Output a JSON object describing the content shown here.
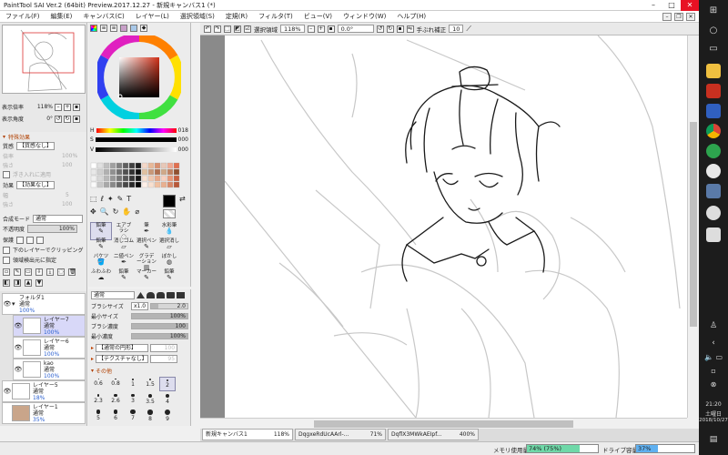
{
  "window": {
    "title": "PaintTool SAI Ver.2 (64bit) Preview.2017.12.27 - 新規キャンバス1 (*)"
  },
  "menu": {
    "items": [
      "ファイル(F)",
      "編集(E)",
      "キャンバス(C)",
      "レイヤー(L)",
      "選択領域(S)",
      "定規(R)",
      "フィルタ(T)",
      "ビュー(V)",
      "ウィンドウ(W)",
      "ヘルプ(H)"
    ]
  },
  "navigator": {
    "zoom_label": "表示倍率",
    "zoom_value": "118%",
    "angle_label": "表示角度",
    "angle_value": "0°"
  },
  "layer_props": {
    "section_label": "特殊効果",
    "texture_label": "質感",
    "texture_value": "【質感なし】",
    "scale_label": "倍率",
    "scale_value": "100%",
    "strength_label": "強さ",
    "strength_value": "100",
    "emboss_label": "浮き入れに適用",
    "effect_label": "効果",
    "effect_value": "【効果なし】",
    "width_label": "幅",
    "width_value": "5",
    "strength2_label": "強さ",
    "strength2_value": "100",
    "blend_label": "合成モード",
    "blend_value": "通常",
    "opacity_label": "不透明度",
    "opacity_value": "100%",
    "protect_label": "保護",
    "clip_label": "下のレイヤーでクリッピング",
    "detect_label": "領域検出元に指定"
  },
  "layers": [
    {
      "name": "フォルダ1",
      "mode": "通常",
      "opacity": "100%"
    },
    {
      "name": "レイヤー7",
      "mode": "通常",
      "opacity": "100%"
    },
    {
      "name": "レイヤー6",
      "mode": "通常",
      "opacity": "100%"
    },
    {
      "name": "kao",
      "mode": "通常",
      "opacity": "100%"
    },
    {
      "name": "レイヤー5",
      "mode": "通常",
      "opacity": "18%"
    },
    {
      "name": "レイヤー1",
      "mode": "通常",
      "opacity": "35%"
    }
  ],
  "color": {
    "h_label": "H",
    "h_value": "018",
    "s_label": "S",
    "s_value": "000",
    "v_label": "V",
    "v_value": "000"
  },
  "tools": [
    {
      "label": "鉛筆"
    },
    {
      "label": "エアブラシ"
    },
    {
      "label": "筆"
    },
    {
      "label": "水彩筆"
    },
    {
      "label": "鉛筆"
    },
    {
      "label": "消しゴム"
    },
    {
      "label": "選択ペン"
    },
    {
      "label": "選択消し"
    },
    {
      "label": "バケツ"
    },
    {
      "label": "二値ペン"
    },
    {
      "label": "グラデーション"
    },
    {
      "label": "ぼかし"
    },
    {
      "label": "ふわふわ"
    },
    {
      "label": "鉛筆"
    },
    {
      "label": "マーカー"
    },
    {
      "label": "鉛筆"
    }
  ],
  "brush": {
    "mode_value": "通常",
    "size_label": "ブラシサイズ",
    "size_mult": "x1.0",
    "size_value": "2.0",
    "min_size_label": "最小サイズ",
    "min_size_value": "100%",
    "density_label": "ブラシ濃度",
    "density_value": "100",
    "min_density_label": "最小濃度",
    "min_density_value": "100%",
    "shape_value": "【通常の円形】",
    "shape_num": "100",
    "texture_value": "【テクスチャなし】",
    "texture_num": "95",
    "other_label": "その他",
    "sizes": [
      "0.6",
      "0.8",
      "1",
      "1.5",
      "2",
      "2.3",
      "2.6",
      "3",
      "3.5",
      "4",
      "5",
      "6",
      "7",
      "8",
      "9"
    ]
  },
  "canvasbar": {
    "selection_label": "選択領域",
    "zoom": "118%",
    "angle": "0.0°",
    "stabilizer_label": "手ぶれ補正",
    "stabilizer_value": "10"
  },
  "tabs": [
    {
      "name": "新規キャンバス1",
      "zoom": "118%"
    },
    {
      "name": "DqgxeRdUcAArl-...",
      "zoom": "71%"
    },
    {
      "name": "DqflX3MWkAEIpf...",
      "zoom": "400%"
    }
  ],
  "status": {
    "mem_label": "メモリ使用量",
    "mem_value": "74% (75%)",
    "mem_fraction": 0.74,
    "drive_label": "ドライブ容量",
    "drive_value": "37%",
    "drive_fraction": 0.37
  },
  "taskbar": {
    "time": "21:20",
    "day": "土曜日",
    "date": "2018/10/27"
  },
  "colors": {
    "accent": "#2b60d0",
    "meter": "#6fd8a8",
    "drive": "#5fb0f0",
    "close": "#e81123"
  }
}
